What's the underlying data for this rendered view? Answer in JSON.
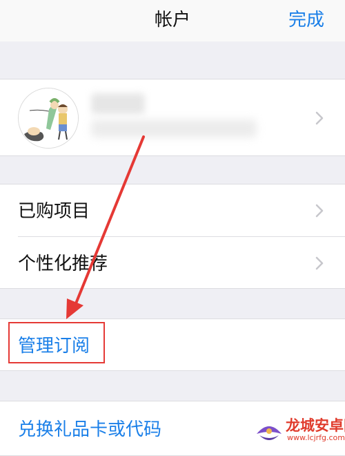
{
  "navbar": {
    "title": "帐户",
    "done_label": "完成"
  },
  "account": {
    "name": "",
    "email": ""
  },
  "purchase_rows": [
    {
      "label": "已购项目"
    },
    {
      "label": "个性化推荐"
    }
  ],
  "manage_row": {
    "label": "管理订阅"
  },
  "redeem_row": {
    "label": "兑换礼品卡或代码"
  },
  "watermark": {
    "title": "龙城安卓网",
    "url": "www.lcjrfg.com"
  },
  "colors": {
    "accent": "#1a7fe8",
    "annotation": "#e53935",
    "background": "#efeff4"
  },
  "icons": [
    "chevron-right-icon",
    "avatar-illustration",
    "annotation-arrow"
  ]
}
